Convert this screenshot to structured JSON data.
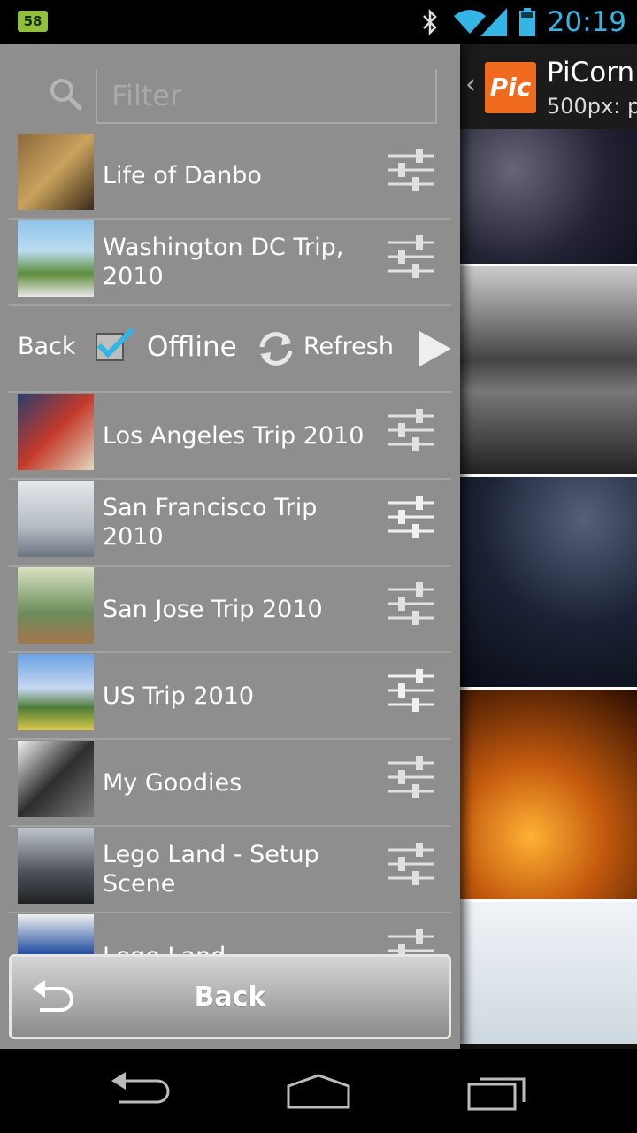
{
  "status_bar": {
    "notification_badge": "58",
    "time": "20:19",
    "icons": [
      "bluetooth-icon",
      "wifi-icon",
      "signal-icon",
      "battery-icon"
    ],
    "clock_color": "#33b5e5"
  },
  "filter": {
    "placeholder": "Filter",
    "value": ""
  },
  "albums_top": [
    {
      "title": "Life of Danbo"
    },
    {
      "title": "Washington DC Trip, 2010"
    }
  ],
  "actions": {
    "back_label": "Back",
    "offline_label": "Offline",
    "offline_checked": true,
    "refresh_label": "Refresh"
  },
  "albums_bottom": [
    {
      "title": "Los Angeles Trip 2010"
    },
    {
      "title": "San Francisco Trip 2010"
    },
    {
      "title": "San Jose Trip 2010"
    },
    {
      "title": "US Trip 2010"
    },
    {
      "title": "My Goodies"
    },
    {
      "title": "Lego Land - Setup Scene"
    },
    {
      "title": "Lego Land"
    }
  ],
  "bottom_button": {
    "label": "Back"
  },
  "background_app": {
    "logo_text": "Pic",
    "title": "PiCorn",
    "subtitle": "500px: p",
    "accent_color": "#f06a1d"
  },
  "nav_bar": {
    "icons": [
      "back-nav-icon",
      "home-nav-icon",
      "recents-nav-icon"
    ]
  }
}
